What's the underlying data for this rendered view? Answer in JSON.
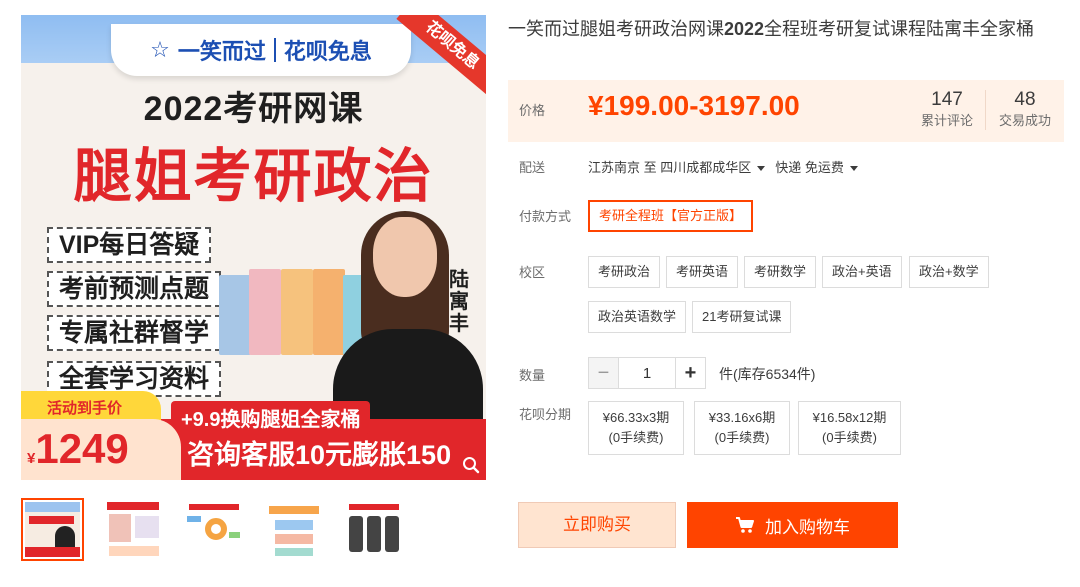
{
  "gallery": {
    "banner_brand": "一笑而过",
    "banner_tag": "花呗免息",
    "ribbon": "花呗免息",
    "headline_1": "2022考研网课",
    "headline_2": "腿姐考研政治",
    "features": [
      "VIP每日答疑",
      "考前预测点题",
      "专属社群督学",
      "全套学习资料"
    ],
    "teacher_name": "陆寓丰",
    "promo_label": "活动到手价",
    "promo_yen": "¥",
    "promo_price": "1249",
    "promo_sub": "+9.9换购腿姐全家桶",
    "promo_main": "咨询客服10元膨胀150",
    "thumbnails": [
      {
        "active": true
      },
      {
        "active": false
      },
      {
        "active": false
      },
      {
        "active": false
      },
      {
        "active": false
      }
    ]
  },
  "product": {
    "title_prefix": "一笑而过腿姐考研政治网课",
    "title_year": "2022",
    "title_suffix": "全程班考研复试课程陆寓丰全家桶"
  },
  "price": {
    "label": "价格",
    "value": "¥199.00-3197.00",
    "reviews_count": "147",
    "reviews_label": "累计评论",
    "sales_count": "48",
    "sales_label": "交易成功"
  },
  "shipping": {
    "label": "配送",
    "from": "江苏南京 至",
    "to": "四川成都成华区",
    "method": "快递 免运费"
  },
  "payment": {
    "label": "付款方式",
    "selected": "考研全程班【官方正版】"
  },
  "campus": {
    "label": "校区",
    "options": [
      "考研政治",
      "考研英语",
      "考研数学",
      "政治+英语",
      "政治+数学",
      "政治英语数学",
      "21考研复试课"
    ]
  },
  "quantity": {
    "label": "数量",
    "minus": "−",
    "plus": "+",
    "value": "1",
    "stock_text": "件(库存6534件)"
  },
  "installment": {
    "label": "花呗分期",
    "options": [
      {
        "line1": "¥66.33x3期",
        "line2": "(0手续费)"
      },
      {
        "line1": "¥33.16x6期",
        "line2": "(0手续费)"
      },
      {
        "line1": "¥16.58x12期",
        "line2": "(0手续费)"
      }
    ]
  },
  "actions": {
    "buy_now": "立即购买",
    "add_to_cart": "加入购物车"
  },
  "colors": {
    "accent": "#ff4400",
    "price_bg": "#fff2e8",
    "brand_red": "#e1262a"
  }
}
